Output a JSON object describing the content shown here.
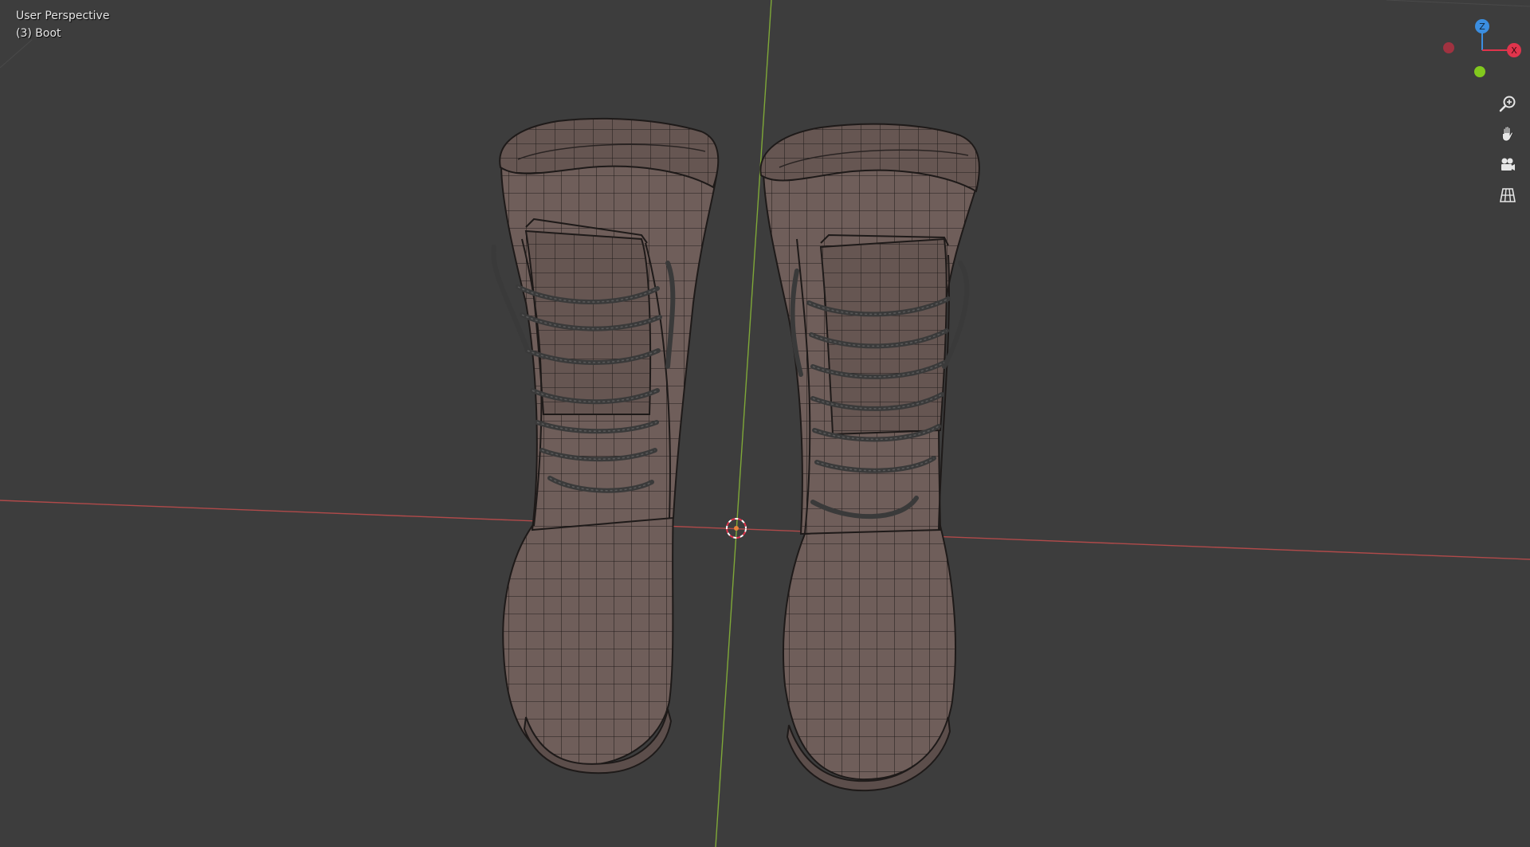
{
  "viewport": {
    "view_mode": "User Perspective",
    "object_info": "(3) Boot"
  },
  "axis_gizmo": {
    "z_label": "Z",
    "x_label": "X",
    "z_color": "#3b8ee0",
    "x_color": "#e0344c",
    "y_color": "#82c91e",
    "neg_x_color": "#a03240"
  },
  "nav_controls": [
    {
      "name": "zoom-icon"
    },
    {
      "name": "pan-hand-icon"
    },
    {
      "name": "camera-icon"
    },
    {
      "name": "perspective-grid-icon"
    }
  ],
  "colors": {
    "background": "#3d3d3d",
    "x_axis_line": "#b04a4a",
    "y_axis_line": "#7fa838",
    "boot_fill": "#6e5d59",
    "boot_wire": "#1e1a19",
    "lace": "#3a3a3a",
    "origin": "#e8843a"
  }
}
